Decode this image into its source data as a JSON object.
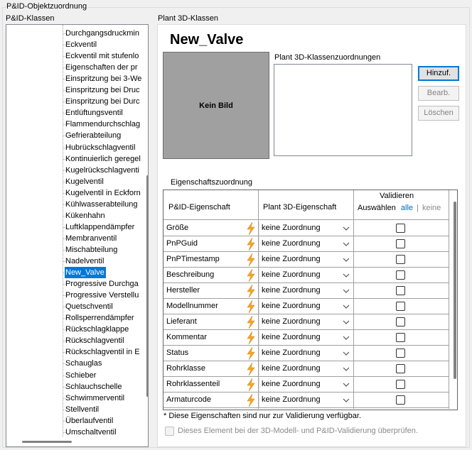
{
  "window": {
    "group_title": "P&ID-Objektzuordnung",
    "left_label": "P&ID-Klassen",
    "right_label": "Plant 3D-Klassen"
  },
  "tree": {
    "items": [
      "Durchgangsdruckmin",
      "Eckventil",
      "Eckventil mit stufenlo",
      "Eigenschaften der pr",
      "Einspritzung bei 3-We",
      "Einspritzung bei Druc",
      "Einspritzung bei Durc",
      "Entlüftungsventil",
      "Flammendurchschlag",
      "Gefrierabteilung",
      "Hubrückschlagventil",
      "Kontinuierlich geregel",
      "Kugelrückschlagventi",
      "Kugelventil",
      "Kugelventil in Eckforn",
      "Kühlwasserabteilung",
      "Kükenhahn",
      "Luftklappendämpfer",
      "Membranventil",
      "Mischabteilung",
      "Nadelventil",
      "New_Valve",
      "Progressive Durchga",
      "Progressive Verstellu",
      "Quetschventil",
      "Rollsperrendämpfer",
      "Rückschlagklappe",
      "Rückschlagventil",
      "Rückschlagventil in E",
      "Schauglas",
      "Schieber",
      "Schlauchschelle",
      "Schwimmerventil",
      "Stellventil",
      "Überlaufventil",
      "Umschaltventil"
    ],
    "selected_index": 21
  },
  "class_panel": {
    "title": "New_Valve",
    "image_placeholder": "Kein Bild",
    "assignments_label": "Plant 3D-Klassenzuordnungen",
    "buttons": {
      "add": "Hinzuf.",
      "edit": "Bearb.",
      "delete": "Löschen"
    }
  },
  "property_mapping": {
    "label": "Eigenschaftszuordnung",
    "headers": {
      "pid_property": "P&ID-Eigenschaft",
      "plant_property": "Plant 3D-Eigenschaft",
      "validate": "Validieren",
      "select": "Auswählen",
      "all": "alle",
      "separator": "|",
      "none": "keine"
    },
    "rows": [
      {
        "name": "Größe",
        "mapping": "keine Zuordnung"
      },
      {
        "name": "PnPGuid",
        "mapping": "keine Zuordnung"
      },
      {
        "name": "PnPTimestamp",
        "mapping": "keine Zuordnung"
      },
      {
        "name": "Beschreibung",
        "mapping": "keine Zuordnung"
      },
      {
        "name": "Hersteller",
        "mapping": "keine Zuordnung"
      },
      {
        "name": "Modellnummer",
        "mapping": "keine Zuordnung"
      },
      {
        "name": "Lieferant",
        "mapping": "keine Zuordnung"
      },
      {
        "name": "Kommentar",
        "mapping": "keine Zuordnung"
      },
      {
        "name": "Status",
        "mapping": "keine Zuordnung"
      },
      {
        "name": "Rohrklasse",
        "mapping": "keine Zuordnung"
      },
      {
        "name": "Rohrklassenteil",
        "mapping": "keine Zuordnung"
      },
      {
        "name": "Armaturcode",
        "mapping": "keine Zuordnung"
      }
    ],
    "footnote": "* Diese Eigenschaften sind nur zur Validierung verfügbar.",
    "validate_element_label": "Dieses Element bei der 3D-Modell- und P&ID-Validierung überprüfen."
  },
  "colors": {
    "selection": "#0078d7",
    "bolt": "#f5a623",
    "link": "#0066cc"
  }
}
